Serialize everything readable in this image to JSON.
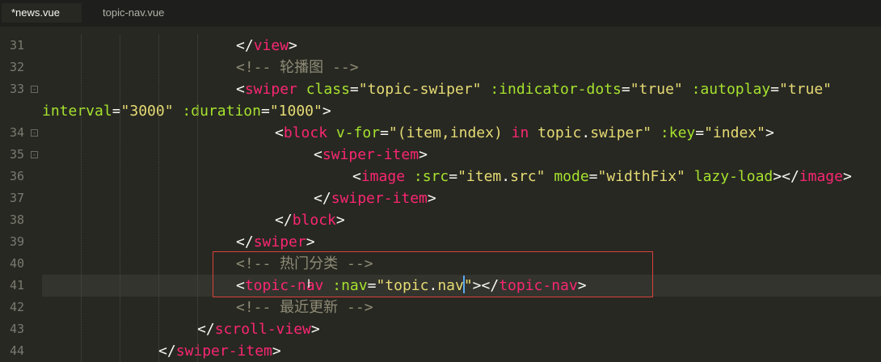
{
  "tabs": [
    {
      "label": "*news.vue",
      "active": true
    },
    {
      "label": "topic-nav.vue",
      "active": false
    }
  ],
  "editor": {
    "current_line": "41",
    "lines": [
      {
        "num": "31",
        "tokens": [
          [
            "p",
            "</"
          ],
          [
            "t",
            "view"
          ],
          [
            "p",
            ">"
          ]
        ]
      },
      {
        "num": "32",
        "tokens": [
          [
            "c",
            "<!-- 轮播图 -->"
          ]
        ]
      },
      {
        "num": "33",
        "fold": "-",
        "tokens": [
          [
            "p",
            "<"
          ],
          [
            "t",
            "swiper"
          ],
          [
            "p",
            " "
          ],
          [
            "a",
            "class"
          ],
          [
            "p",
            "="
          ],
          [
            "s",
            "\"topic-swiper\""
          ],
          [
            "p",
            " "
          ],
          [
            "a",
            ":indicator-dots"
          ],
          [
            "p",
            "="
          ],
          [
            "s",
            "\"true\""
          ],
          [
            "p",
            " "
          ],
          [
            "a",
            ":autoplay"
          ],
          [
            "p",
            "="
          ],
          [
            "s",
            "\"true\""
          ]
        ]
      },
      {
        "num": "",
        "tokens": [
          [
            "a",
            "interval"
          ],
          [
            "p",
            "="
          ],
          [
            "s",
            "\"3000\""
          ],
          [
            "p",
            " "
          ],
          [
            "a",
            ":duration"
          ],
          [
            "p",
            "="
          ],
          [
            "s",
            "\"1000\""
          ],
          [
            "p",
            ">"
          ]
        ]
      },
      {
        "num": "34",
        "fold": "-",
        "tokens": [
          [
            "p",
            "<"
          ],
          [
            "t",
            "block"
          ],
          [
            "p",
            " "
          ],
          [
            "a",
            "v-for"
          ],
          [
            "p",
            "="
          ],
          [
            "s",
            "\"(item,index) "
          ],
          [
            "k",
            "in"
          ],
          [
            "s",
            " topic"
          ],
          [
            "p",
            "."
          ],
          [
            "s",
            "swiper\""
          ],
          [
            "p",
            " "
          ],
          [
            "a",
            ":key"
          ],
          [
            "p",
            "="
          ],
          [
            "s",
            "\"index\""
          ],
          [
            "p",
            ">"
          ]
        ]
      },
      {
        "num": "35",
        "fold": "-",
        "tokens": [
          [
            "p",
            "<"
          ],
          [
            "t",
            "swiper-item"
          ],
          [
            "p",
            ">"
          ]
        ]
      },
      {
        "num": "36",
        "tokens": [
          [
            "p",
            "<"
          ],
          [
            "t",
            "image"
          ],
          [
            "p",
            " "
          ],
          [
            "a",
            ":src"
          ],
          [
            "p",
            "="
          ],
          [
            "s",
            "\"item"
          ],
          [
            "p",
            "."
          ],
          [
            "s",
            "src\""
          ],
          [
            "p",
            " "
          ],
          [
            "a",
            "mode"
          ],
          [
            "p",
            "="
          ],
          [
            "s",
            "\"widthFix\""
          ],
          [
            "p",
            " "
          ],
          [
            "a",
            "lazy-load"
          ],
          [
            "p",
            "></"
          ],
          [
            "t",
            "image"
          ],
          [
            "p",
            ">"
          ]
        ]
      },
      {
        "num": "37",
        "tokens": [
          [
            "p",
            "</"
          ],
          [
            "t",
            "swiper-item"
          ],
          [
            "p",
            ">"
          ]
        ]
      },
      {
        "num": "38",
        "tokens": [
          [
            "p",
            "</"
          ],
          [
            "t",
            "block"
          ],
          [
            "p",
            ">"
          ]
        ]
      },
      {
        "num": "39",
        "tokens": [
          [
            "p",
            "</"
          ],
          [
            "t",
            "swiper"
          ],
          [
            "p",
            ">"
          ]
        ]
      },
      {
        "num": "40",
        "tokens": [
          [
            "c",
            "<!-- 热门分类 -->"
          ]
        ]
      },
      {
        "num": "41",
        "tokens": [
          [
            "p",
            "<"
          ],
          [
            "t",
            "topic-nav"
          ],
          [
            "p",
            " "
          ],
          [
            "a",
            ":nav"
          ],
          [
            "p",
            "="
          ],
          [
            "s",
            "\"topic"
          ],
          [
            "p",
            "."
          ],
          [
            "s",
            "nav"
          ],
          [
            "caret",
            ""
          ],
          [
            "s",
            "\""
          ],
          [
            "p",
            "></"
          ],
          [
            "t",
            "topic-nav"
          ],
          [
            "p",
            ">"
          ]
        ]
      },
      {
        "num": "42",
        "tokens": [
          [
            "c",
            "<!-- 最近更新 -->"
          ]
        ]
      },
      {
        "num": "43",
        "tokens": [
          [
            "p",
            "</"
          ],
          [
            "t",
            "scroll-view"
          ],
          [
            "p",
            ">"
          ]
        ]
      },
      {
        "num": "44",
        "tokens": [
          [
            "p",
            "</"
          ],
          [
            "t",
            "swiper-item"
          ],
          [
            "p",
            ">"
          ]
        ]
      }
    ]
  },
  "colors": {
    "background": "#272822",
    "tag": "#f92672",
    "attribute": "#a6e22e",
    "string": "#e6db74",
    "comment": "#8f8b76",
    "highlight_box": "#d9413b",
    "caret": "#5aa9f0"
  }
}
